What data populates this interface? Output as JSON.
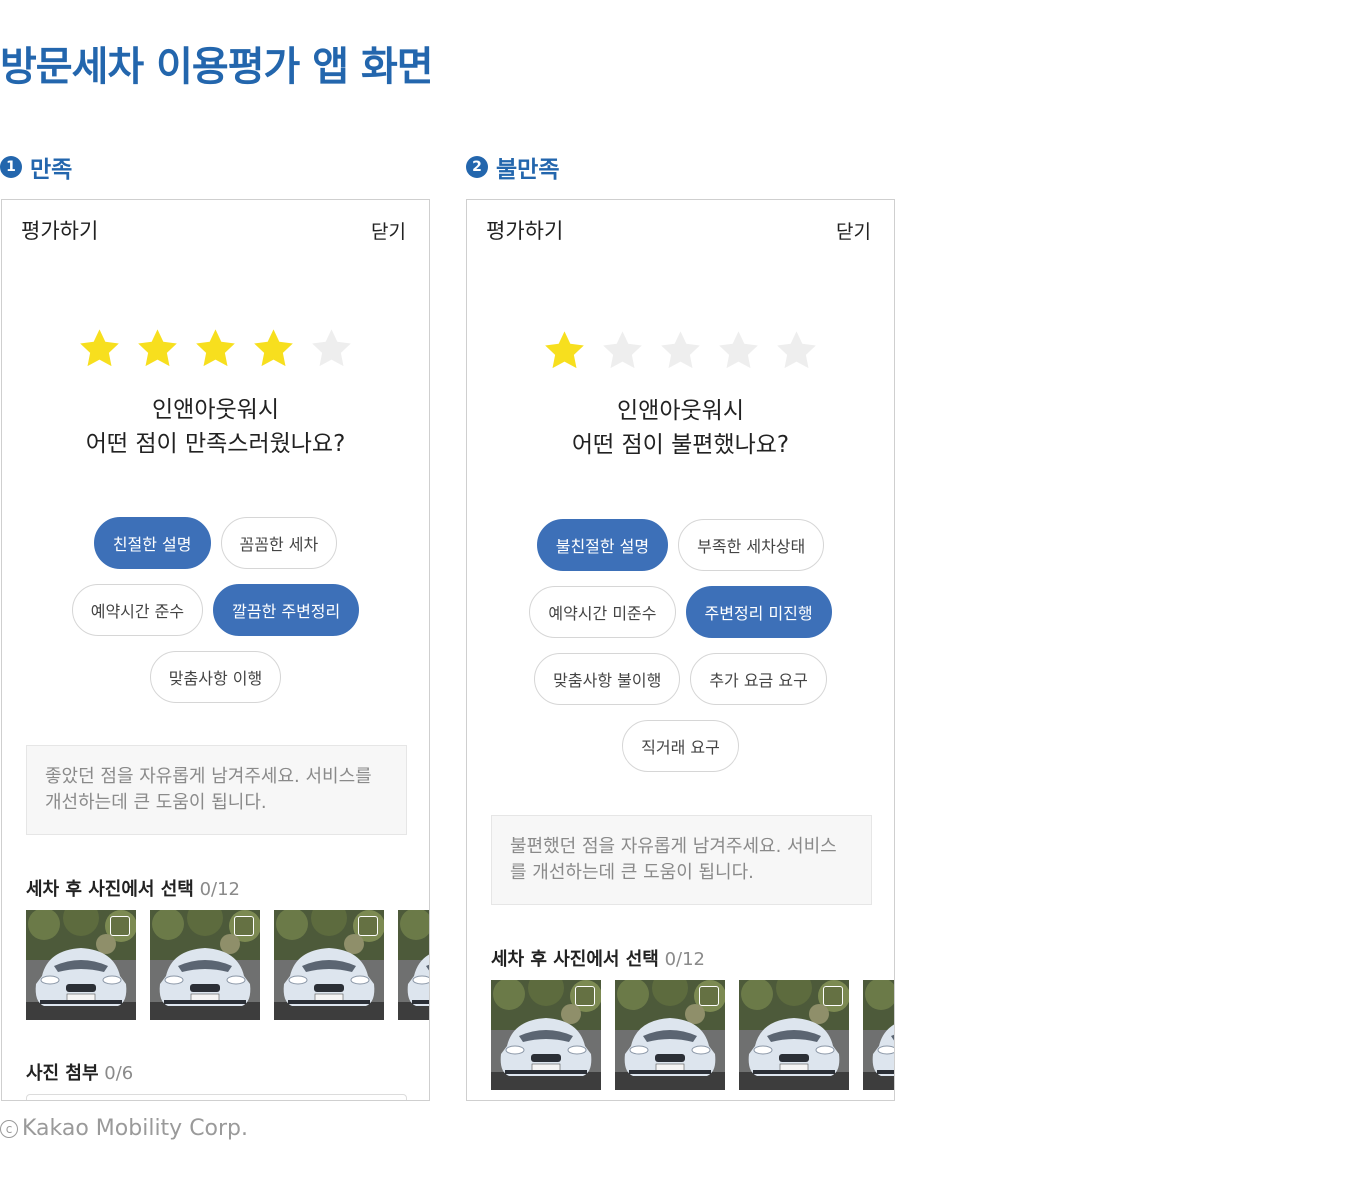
{
  "page": {
    "title": "방문세차 이용평가 앱 화면"
  },
  "sections": [
    {
      "number": "1",
      "label": "만족",
      "screen": {
        "title": "평가하기",
        "close_label": "닫기",
        "rating": 4,
        "rating_max": 5,
        "question_line1": "인앤아웃워시",
        "question_line2": "어떤 점이 만족스러웠나요?",
        "chips": [
          {
            "label": "친절한 설명",
            "selected": true
          },
          {
            "label": "꼼꼼한 세차",
            "selected": false
          },
          {
            "label": "예약시간 준수",
            "selected": false
          },
          {
            "label": "깔끔한 주변정리",
            "selected": true
          },
          {
            "label": "맞춤사항 이행",
            "selected": false
          }
        ],
        "textarea_placeholder": "좋았던 점을 자유롭게 남겨주세요. 서비스를 개선하는데 큰 도움이 됩니다.",
        "photo_select_label": "세차 후 사진에서 선택",
        "photo_select_count": "0/12",
        "photos": [
          "car-photo",
          "car-photo",
          "car-photo",
          "car-photo"
        ],
        "attach_label": "사진 첨부",
        "attach_count": "0/6"
      }
    },
    {
      "number": "2",
      "label": "불만족",
      "screen": {
        "title": "평가하기",
        "close_label": "닫기",
        "rating": 1,
        "rating_max": 5,
        "question_line1": "인앤아웃워시",
        "question_line2": "어떤 점이 불편했나요?",
        "chips": [
          {
            "label": "불친절한 설명",
            "selected": true
          },
          {
            "label": "부족한 세차상태",
            "selected": false
          },
          {
            "label": "예약시간 미준수",
            "selected": false
          },
          {
            "label": "주변정리 미진행",
            "selected": true
          },
          {
            "label": "맞춤사항 불이행",
            "selected": false
          },
          {
            "label": "추가 요금 요구",
            "selected": false
          },
          {
            "label": "직거래 요구",
            "selected": false
          }
        ],
        "textarea_placeholder": "불편했던 점을 자유롭게 남겨주세요. 서비스를 개선하는데 큰 도움이 됩니다.",
        "photo_select_label": "세차 후 사진에서 선택",
        "photo_select_count": "0/12",
        "photos": [
          "car-photo",
          "car-photo",
          "car-photo",
          "car-photo"
        ]
      }
    }
  ],
  "colors": {
    "title_blue": "#2366ad",
    "chip_selected": "#3d70b8",
    "star_on": "#f7df1e",
    "star_off": "#eeeeee"
  },
  "footer": {
    "copyright": "Kakao Mobility Corp."
  }
}
